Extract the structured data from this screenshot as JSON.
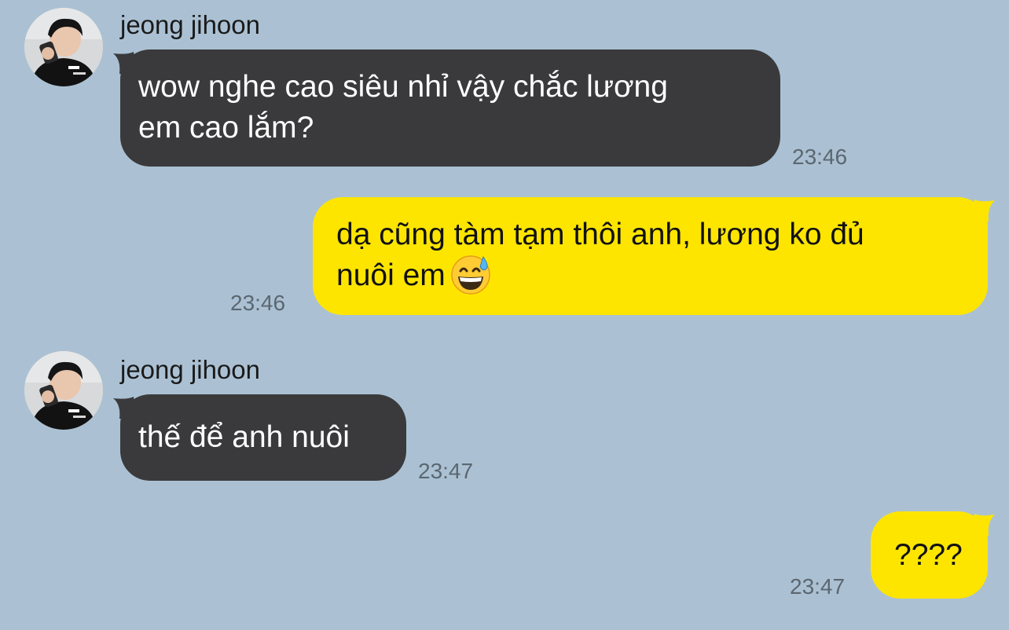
{
  "colors": {
    "background": "#abc1d3",
    "incoming_bubble": "#3a3a3c",
    "outgoing_bubble": "#fee500",
    "timestamp": "#5b6770"
  },
  "messages": [
    {
      "direction": "incoming",
      "sender": "jeong jihoon",
      "lines": [
        "wow nghe cao siêu nhỉ vậy chắc lương",
        "em cao lắm?"
      ],
      "time": "23:46"
    },
    {
      "direction": "outgoing",
      "lines": [
        "dạ cũng tàm tạm thôi anh, lương ko đủ",
        "nuôi em"
      ],
      "emoji": "grinning-face-with-sweat-icon",
      "time": "23:46"
    },
    {
      "direction": "incoming",
      "sender": "jeong jihoon",
      "lines": [
        "thế để anh nuôi"
      ],
      "time": "23:47"
    },
    {
      "direction": "outgoing",
      "lines": [
        "????"
      ],
      "time": "23:47"
    }
  ]
}
